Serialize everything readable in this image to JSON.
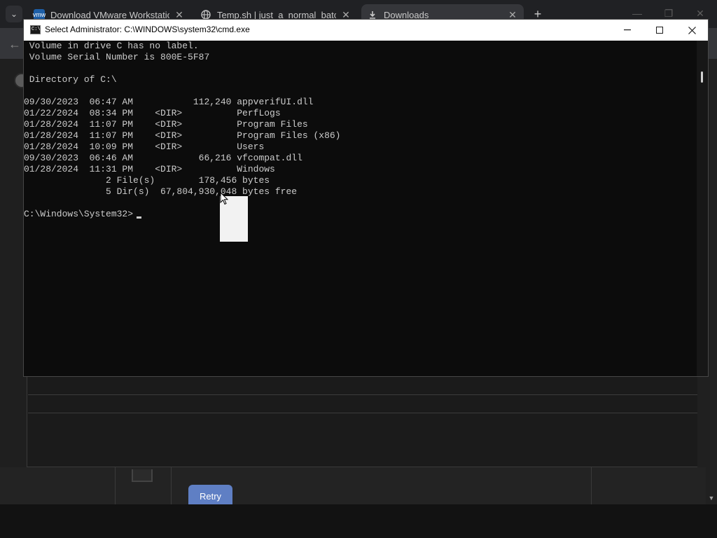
{
  "browser": {
    "tabs": [
      {
        "title": "Download VMware Workstation",
        "favicon": "vmw",
        "active": false
      },
      {
        "title": "Temp.sh | just_a_normal_batch",
        "favicon": "globe-icon",
        "active": false
      },
      {
        "title": "Downloads",
        "favicon": "download-icon",
        "active": true
      }
    ],
    "tab_list_glyph": "⌄",
    "new_tab_glyph": "+",
    "back_glyph": "←"
  },
  "page": {
    "retry_label": "Retry"
  },
  "cmd": {
    "title": "Select Administrator: C:\\WINDOWS\\system32\\cmd.exe",
    "icon_text": "C:\\",
    "lines": [
      " Volume in drive C has no label.",
      " Volume Serial Number is 800E-5F87",
      "",
      " Directory of C:\\",
      "",
      "09/30/2023  06:47 AM           112,240 appverifUI.dll",
      "01/22/2024  08:34 PM    <DIR>          PerfLogs",
      "01/28/2024  11:07 PM    <DIR>          Program Files",
      "01/28/2024  11:07 PM    <DIR>          Program Files (x86)",
      "01/28/2024  10:09 PM    <DIR>          Users",
      "09/30/2023  06:46 AM            66,216 vfcompat.dll",
      "01/28/2024  11:31 PM    <DIR>          Windows",
      "               2 File(s)        178,456 bytes",
      "               5 Dir(s)  67,804,930,048 bytes free",
      "",
      "C:\\Windows\\System32>"
    ]
  },
  "colors": {
    "console_bg": "#0c0c0c",
    "console_text": "#cccccc",
    "retry_accent": "#5f7fc4"
  }
}
